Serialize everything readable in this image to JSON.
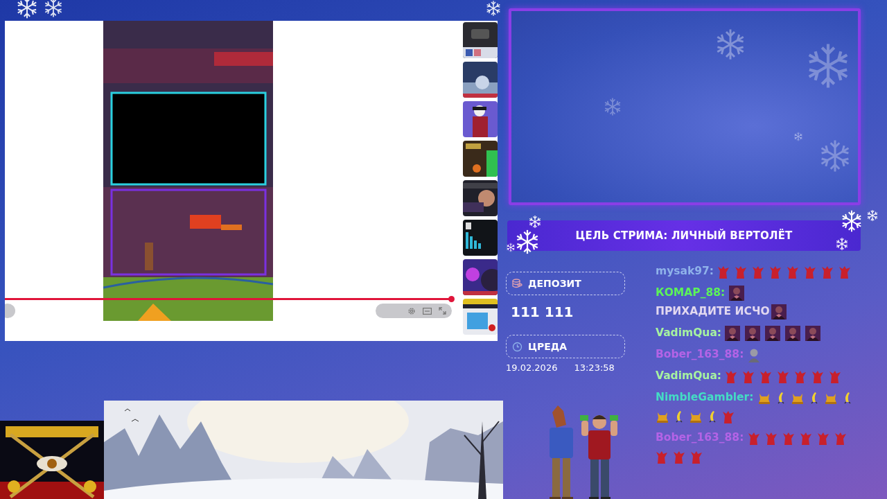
{
  "player": {
    "progress": {
      "level": 0.99
    }
  },
  "goal_banner": {
    "text": "ЦЕЛЬ СТРИМА: ЛИЧНЫЙ ВЕРТОЛЁТ"
  },
  "deposit": {
    "label": "ДЕПОЗИТ",
    "value": "111 111"
  },
  "day": {
    "label": "ЦРЕДА",
    "date": "19.02.2026",
    "time": "13:23:58"
  },
  "chat": [
    {
      "user": "mysak97:",
      "color": "#8fb2ea",
      "parts": [
        {
          "kind": "creature"
        },
        {
          "kind": "creature"
        },
        {
          "kind": "creature"
        },
        {
          "kind": "creature"
        },
        {
          "kind": "creature"
        },
        {
          "kind": "creature"
        },
        {
          "kind": "creature"
        },
        {
          "kind": "creature"
        }
      ]
    },
    {
      "user": "КОМАР_88:",
      "color": "#5cf25a",
      "parts": [
        {
          "kind": "portrait"
        },
        {
          "kind": "text",
          "text": "ПРИХАДИТЕ ИСЧО"
        },
        {
          "kind": "portrait"
        }
      ]
    },
    {
      "user": "VadimQua:",
      "color": "#a6f2a0",
      "parts": [
        {
          "kind": "portrait"
        },
        {
          "kind": "portrait"
        },
        {
          "kind": "portrait"
        },
        {
          "kind": "portrait"
        },
        {
          "kind": "portrait"
        }
      ]
    },
    {
      "user": "Bober_163_88:",
      "color": "#b463e6",
      "parts": [
        {
          "kind": "person"
        }
      ]
    },
    {
      "user": "VadimQua:",
      "color": "#a6f2a0",
      "parts": [
        {
          "kind": "creature"
        },
        {
          "kind": "creature"
        },
        {
          "kind": "creature"
        },
        {
          "kind": "creature"
        },
        {
          "kind": "creature"
        },
        {
          "kind": "creature"
        },
        {
          "kind": "creature"
        }
      ]
    },
    {
      "user": "NimbleGambler:",
      "color": "#44dcc4",
      "parts": [
        {
          "kind": "cat"
        },
        {
          "kind": "banana"
        },
        {
          "kind": "cat"
        },
        {
          "kind": "banana"
        },
        {
          "kind": "cat"
        },
        {
          "kind": "banana"
        },
        {
          "kind": "cat"
        },
        {
          "kind": "banana"
        },
        {
          "kind": "cat"
        },
        {
          "kind": "banana"
        },
        {
          "kind": "creature"
        }
      ]
    },
    {
      "user": "Bober_163_88:",
      "color": "#b463e6",
      "parts": [
        {
          "kind": "creature"
        },
        {
          "kind": "creature"
        },
        {
          "kind": "creature"
        },
        {
          "kind": "creature"
        },
        {
          "kind": "creature"
        },
        {
          "kind": "creature"
        },
        {
          "kind": "creature"
        },
        {
          "kind": "creature"
        },
        {
          "kind": "creature"
        }
      ]
    }
  ]
}
